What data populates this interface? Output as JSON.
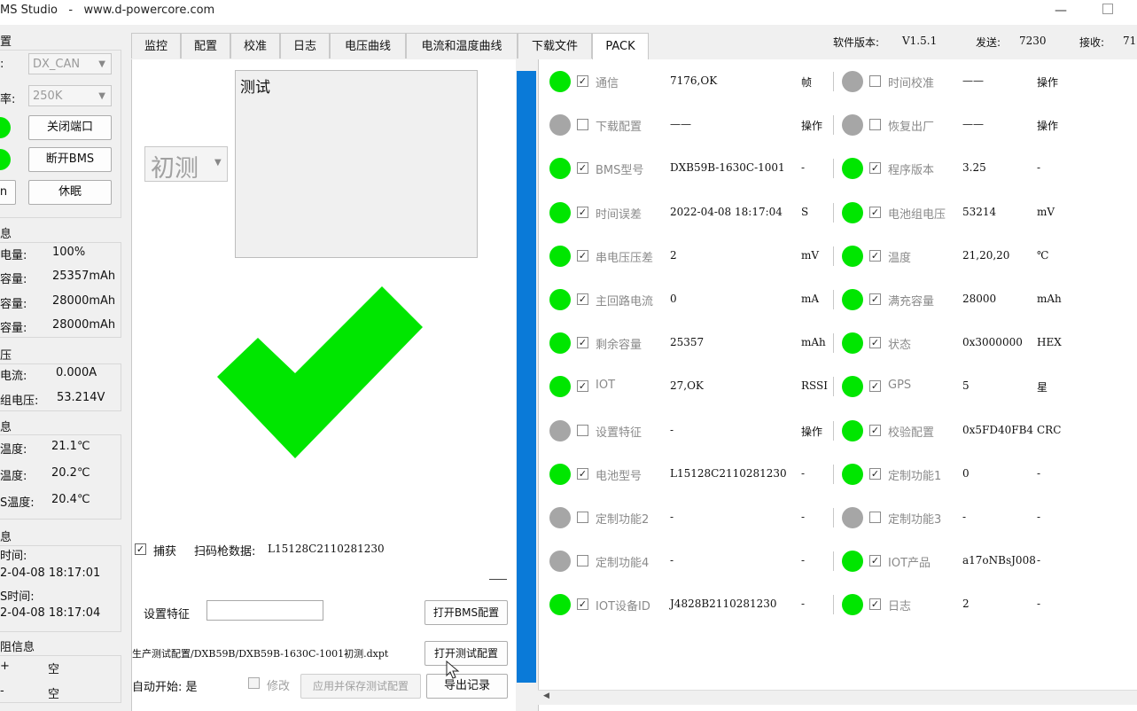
{
  "window": {
    "title": "MS Studio   -   www.d-powercore.com",
    "minimize": "—"
  },
  "left": {
    "section_port": "置",
    "port_label": ":",
    "port_value": "DX_CAN",
    "baud_label": "率:",
    "baud_value": "250K",
    "close_port": "关闭端口",
    "disconnect_bms": "断开BMS",
    "short_btn": "n",
    "sleep": "休眠",
    "section_info": "息",
    "info_rows": [
      {
        "label": "电量:",
        "value": "100%"
      },
      {
        "label": "容量:",
        "value": "25357mAh"
      },
      {
        "label": "容量:",
        "value": "28000mAh"
      },
      {
        "label": "容量:",
        "value": "28000mAh"
      }
    ],
    "section_volt": "压",
    "volt_rows": [
      {
        "label": "电流:",
        "value": "0.000A"
      },
      {
        "label": "组电压:",
        "value": "53.214V"
      }
    ],
    "section_temp": "息",
    "temp_rows": [
      {
        "label": "温度:",
        "value": "21.1℃"
      },
      {
        "label": "温度:",
        "value": "20.2℃"
      },
      {
        "label": "S温度:",
        "value": "20.4℃"
      }
    ],
    "section_time": "息",
    "time_rows": [
      {
        "label": "时间:"
      },
      {
        "value": "2-04-08  18:17:01"
      },
      {
        "label": "S时间:"
      },
      {
        "value": "2-04-08  18:17:04"
      }
    ],
    "section_res": "阻信息",
    "res_rows": [
      {
        "label": "+",
        "value": "空"
      },
      {
        "label": "-",
        "value": "空"
      }
    ]
  },
  "tabs": [
    "监控",
    "配置",
    "校准",
    "日志",
    "电压曲线",
    "电流和温度曲线",
    "下载文件",
    "PACK"
  ],
  "topinfo": {
    "version_label": "软件版本:",
    "version": "V1.5.1",
    "send_label": "发送:",
    "send": "7230",
    "recv_label": "接收:",
    "recv": "71"
  },
  "mid": {
    "mode_value": "初测",
    "test_text": "测试",
    "capture_label": "捕获",
    "scan_label": "扫码枪数据:",
    "scan_value": "L15128C2110281230",
    "feature_label": "设置特征",
    "feature_value": "",
    "open_bms_config": "打开BMS配置",
    "config_path": "生产测试配置/DXB59B/DXB59B-1630C-1001初测.dxpt",
    "open_test_config": "打开测试配置",
    "auto_start": "自动开始: 是",
    "modify": "修改",
    "apply_save": "应用并保存测试配置",
    "export": "导出记录",
    "check_color": "#00e600"
  },
  "pack_rows": [
    {
      "l": {
        "status": "green",
        "checked": true,
        "label": "通信",
        "value": "7176,OK",
        "unit": "帧"
      },
      "r": {
        "status": "gray",
        "checked": false,
        "label": "时间校准",
        "value": "——",
        "unit": "操作"
      }
    },
    {
      "l": {
        "status": "gray",
        "checked": false,
        "label": "下载配置",
        "value": "——",
        "unit": "操作"
      },
      "r": {
        "status": "gray",
        "checked": false,
        "label": "恢复出厂",
        "value": "——",
        "unit": "操作"
      }
    },
    {
      "l": {
        "status": "green",
        "checked": true,
        "label": "BMS型号",
        "value": "DXB59B-1630C-1001",
        "unit": "-"
      },
      "r": {
        "status": "green",
        "checked": true,
        "label": "程序版本",
        "value": "3.25",
        "unit": "-"
      }
    },
    {
      "l": {
        "status": "green",
        "checked": true,
        "label": "时间误差",
        "value": "2022-04-08  18:17:04",
        "unit": "S"
      },
      "r": {
        "status": "green",
        "checked": true,
        "label": "电池组电压",
        "value": "53214",
        "unit": "mV"
      }
    },
    {
      "l": {
        "status": "green",
        "checked": true,
        "label": "串电压压差",
        "value": "2",
        "unit": "mV"
      },
      "r": {
        "status": "green",
        "checked": true,
        "label": "温度",
        "value": "21,20,20",
        "unit": "℃"
      }
    },
    {
      "l": {
        "status": "green",
        "checked": true,
        "label": "主回路电流",
        "value": "0",
        "unit": "mA"
      },
      "r": {
        "status": "green",
        "checked": true,
        "label": "满充容量",
        "value": "28000",
        "unit": "mAh"
      }
    },
    {
      "l": {
        "status": "green",
        "checked": true,
        "label": "剩余容量",
        "value": "25357",
        "unit": "mAh"
      },
      "r": {
        "status": "green",
        "checked": true,
        "label": "状态",
        "value": "0x3000000",
        "unit": "HEX"
      }
    },
    {
      "l": {
        "status": "green",
        "checked": true,
        "label": "IOT",
        "value": "27,OK",
        "unit": "RSSI"
      },
      "r": {
        "status": "green",
        "checked": true,
        "label": "GPS",
        "value": "5",
        "unit": "星"
      }
    },
    {
      "l": {
        "status": "gray",
        "checked": false,
        "label": "设置特征",
        "value": "-",
        "unit": "操作"
      },
      "r": {
        "status": "green",
        "checked": true,
        "label": "校验配置",
        "value": "0x5FD40FB4",
        "unit": "CRC"
      }
    },
    {
      "l": {
        "status": "green",
        "checked": true,
        "label": "电池型号",
        "value": "L15128C2110281230",
        "unit": "-"
      },
      "r": {
        "status": "green",
        "checked": true,
        "label": "定制功能1",
        "value": "0",
        "unit": "-"
      }
    },
    {
      "l": {
        "status": "gray",
        "checked": false,
        "label": "定制功能2",
        "value": "-",
        "unit": "-"
      },
      "r": {
        "status": "gray",
        "checked": false,
        "label": "定制功能3",
        "value": "-",
        "unit": "-"
      }
    },
    {
      "l": {
        "status": "gray",
        "checked": false,
        "label": "定制功能4",
        "value": "-",
        "unit": "-"
      },
      "r": {
        "status": "green",
        "checked": true,
        "label": "IOT产品",
        "value": "a17oNBsJ008",
        "unit": "-"
      }
    },
    {
      "l": {
        "status": "green",
        "checked": true,
        "label": "IOT设备ID",
        "value": "J4828B2110281230",
        "unit": "-"
      },
      "r": {
        "status": "green",
        "checked": true,
        "label": "日志",
        "value": "2",
        "unit": "-"
      }
    }
  ],
  "colors": {
    "green": "#00e600",
    "gray": "#a6a6a6",
    "blue_bar": "#0a7ad8"
  }
}
